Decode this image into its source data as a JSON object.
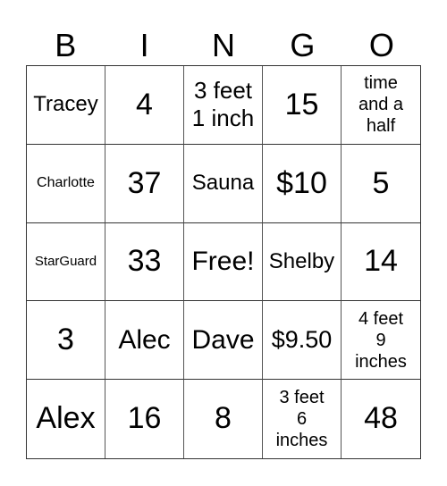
{
  "header": [
    "B",
    "I",
    "N",
    "G",
    "O"
  ],
  "cells": [
    [
      "Tracey",
      "4",
      "3 feet\n1 inch",
      "15",
      "time\nand a\nhalf"
    ],
    [
      "Charlotte",
      "37",
      "Sauna",
      "$10",
      "5"
    ],
    [
      "StarGuard",
      "33",
      "Free!",
      "Shelby",
      "14"
    ],
    [
      "3",
      "Alec",
      "Dave",
      "$9.50",
      "4 feet\n9\ninches"
    ],
    [
      "Alex",
      "16",
      "8",
      "3 feet\n6\ninches",
      "48"
    ]
  ]
}
